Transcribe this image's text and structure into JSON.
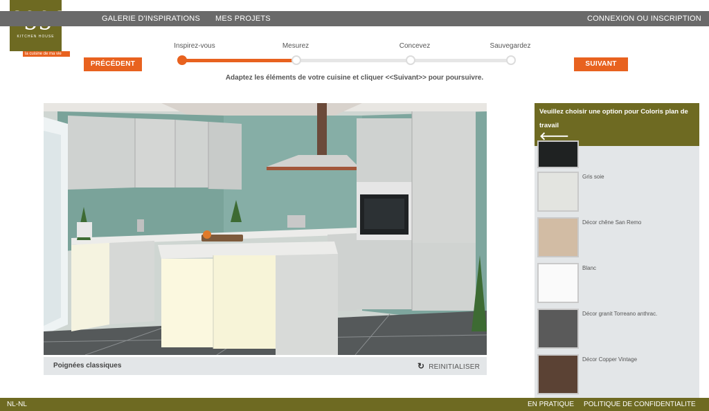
{
  "logo": {
    "word": "eggo",
    "subtitle": "KITCHEN HOUSE",
    "tagline": "la cuisine de ma vie"
  },
  "nav": {
    "gallery": "GALERIE D'INSPIRATIONS",
    "projects": "MES PROJETS",
    "login": "CONNEXION OU INSCRIPTION"
  },
  "buttons": {
    "previous": "PRÉCÉDENT",
    "next": "SUIVANT"
  },
  "stepper": {
    "steps": [
      "Inspirez-vous",
      "Mesurez",
      "Concevez",
      "Sauvegardez"
    ],
    "current_step": 1,
    "progress": 0.35
  },
  "instruction": "Adaptez les éléments de votre cuisine et cliquer <<Suivant>> pour poursuivre.",
  "preview": {
    "handles_label": "Poignées classiques",
    "reset_label": "REINITIALISER"
  },
  "panel": {
    "title": "Veuillez choisir une option pour Coloris plan de travail",
    "back_icon": "arrow-left-icon",
    "options": [
      {
        "label": "",
        "color": "#1f2222"
      },
      {
        "label": "Gris soie",
        "color": "#e3e4e0"
      },
      {
        "label": "Décor chêne San Remo",
        "color": "#d2bca4"
      },
      {
        "label": "Blanc",
        "color": "#fafafa"
      },
      {
        "label": "Décor granit Torreano anthrac.",
        "color": "#5a5a5a"
      },
      {
        "label": "Décor Copper Vintage",
        "color": "#5b4234"
      }
    ]
  },
  "footer": {
    "locale": "NL-NL",
    "practical": "EN PRATIQUE",
    "privacy": "POLITIQUE DE CONFIDENTIALITE"
  },
  "colors": {
    "brand_olive": "#6e6a22",
    "accent_orange": "#e8621f",
    "nav_grey": "#6a6a6a"
  }
}
